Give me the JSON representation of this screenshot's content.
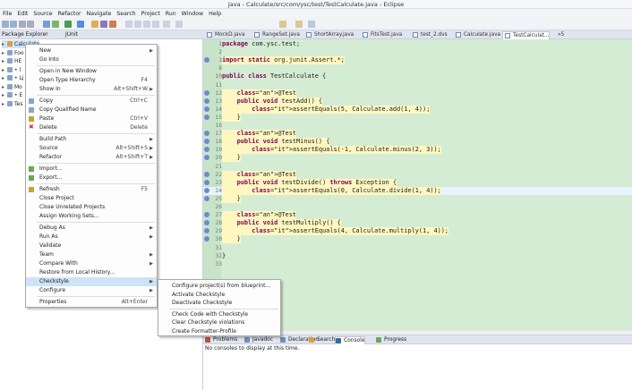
{
  "window": {
    "title": "Java - Calculate/src/com/ysc/test/TestCalculate.java - Eclipse"
  },
  "menubar": [
    "File",
    "Edit",
    "Source",
    "Refactor",
    "Navigate",
    "Search",
    "Project",
    "Run",
    "Window",
    "Help"
  ],
  "left_panel": {
    "tabs": [
      "Package Explorer",
      "JUnit"
    ],
    "tree": [
      {
        "label": "Calculate",
        "selected": true
      },
      {
        "label": "Foo"
      },
      {
        "label": "HE"
      },
      {
        "label": "• l"
      },
      {
        "label": "• Ц"
      },
      {
        "label": "Mo"
      },
      {
        "label": "• E"
      },
      {
        "label": "Tes"
      }
    ]
  },
  "editor_tabs": [
    {
      "label": "MockD.java"
    },
    {
      "label": "RangeSet.java"
    },
    {
      "label": "ShortArray.java"
    },
    {
      "label": "FitsTest.java"
    },
    {
      "label": "test_2.dvs"
    },
    {
      "label": "Calculate.java"
    },
    {
      "label": "TestCalculat...",
      "active": true
    },
    {
      "label": "»5"
    }
  ],
  "code": [
    {
      "n": "1",
      "text": "package com.ysc.test;"
    },
    {
      "n": "2",
      "text": ""
    },
    {
      "n": "3",
      "text": "import static org.junit.Assert.*;",
      "marker": true
    },
    {
      "n": "8",
      "text": ""
    },
    {
      "n": "10",
      "text": "public class TestCalculate {"
    },
    {
      "n": "11",
      "text": ""
    },
    {
      "n": "12",
      "text": "    @Test",
      "marker": true
    },
    {
      "n": "13",
      "text": "    public void testAdd() {",
      "marker": true
    },
    {
      "n": "14",
      "text": "        assertEquals(5, Calculate.add(1, 4));",
      "marker": true
    },
    {
      "n": "15",
      "text": "    }",
      "marker": true
    },
    {
      "n": "16",
      "text": ""
    },
    {
      "n": "17",
      "text": "    @Test",
      "marker": true
    },
    {
      "n": "18",
      "text": "    public void testMinus() {",
      "marker": true
    },
    {
      "n": "19",
      "text": "        assertEquals(-1, Calculate.minus(2, 3));",
      "marker": true
    },
    {
      "n": "20",
      "text": "    }",
      "marker": true
    },
    {
      "n": "21",
      "text": ""
    },
    {
      "n": "22",
      "text": "    @Test",
      "marker": true
    },
    {
      "n": "23",
      "text": "    public void testDivide() throws Exception {",
      "marker": true
    },
    {
      "n": "24",
      "text": "        assertEquals(0, Calculate.divide(1, 4));",
      "marker": true,
      "current": true
    },
    {
      "n": "25",
      "text": "    }",
      "marker": true
    },
    {
      "n": "26",
      "text": ""
    },
    {
      "n": "27",
      "text": "    @Test",
      "marker": true
    },
    {
      "n": "28",
      "text": "    public void testMultiply() {",
      "marker": true
    },
    {
      "n": "29",
      "text": "        assertEquals(4, Calculate.multiply(1, 4));",
      "marker": true
    },
    {
      "n": "30",
      "text": "    }",
      "marker": true
    },
    {
      "n": "31",
      "text": ""
    },
    {
      "n": "32",
      "text": "}"
    },
    {
      "n": "33",
      "text": ""
    }
  ],
  "context_menu": {
    "items": [
      {
        "label": "New",
        "submenu": true
      },
      {
        "label": "Go Into"
      },
      {
        "sep": true
      },
      {
        "label": "Open in New Window"
      },
      {
        "label": "Open Type Hierarchy",
        "shortcut": "F4"
      },
      {
        "label": "Show In",
        "shortcut": "Alt+Shift+W",
        "submenu": true
      },
      {
        "sep": true
      },
      {
        "label": "Copy",
        "shortcut": "Ctrl+C",
        "icon": "copy-icon"
      },
      {
        "label": "Copy Qualified Name",
        "icon": "copy-qualified-icon"
      },
      {
        "label": "Paste",
        "shortcut": "Ctrl+V",
        "icon": "paste-icon"
      },
      {
        "label": "Delete",
        "shortcut": "Delete",
        "icon": "delete-icon"
      },
      {
        "sep": true
      },
      {
        "label": "Build Path",
        "submenu": true
      },
      {
        "label": "Source",
        "shortcut": "Alt+Shift+S",
        "submenu": true
      },
      {
        "label": "Refactor",
        "shortcut": "Alt+Shift+T",
        "submenu": true
      },
      {
        "sep": true
      },
      {
        "label": "Import...",
        "icon": "import-icon"
      },
      {
        "label": "Export...",
        "icon": "export-icon"
      },
      {
        "sep": true
      },
      {
        "label": "Refresh",
        "shortcut": "F5",
        "icon": "refresh-icon"
      },
      {
        "label": "Close Project"
      },
      {
        "label": "Close Unrelated Projects"
      },
      {
        "label": "Assign Working Sets..."
      },
      {
        "sep": true
      },
      {
        "label": "Debug As",
        "submenu": true
      },
      {
        "label": "Run As",
        "submenu": true
      },
      {
        "label": "Validate"
      },
      {
        "label": "Team",
        "submenu": true
      },
      {
        "label": "Compare With",
        "submenu": true
      },
      {
        "label": "Restore from Local History..."
      },
      {
        "label": "Checkstyle",
        "submenu": true,
        "selected": true
      },
      {
        "label": "Configure",
        "submenu": true
      },
      {
        "sep": true
      },
      {
        "label": "Properties",
        "shortcut": "Alt+Enter"
      }
    ]
  },
  "checkstyle_submenu": {
    "items": [
      {
        "label": "Configure project(s) from blueprint..."
      },
      {
        "label": "Activate Checkstyle"
      },
      {
        "label": "Deactivate Checkstyle"
      },
      {
        "sep": true
      },
      {
        "label": "Check Code with Checkstyle"
      },
      {
        "label": "Clear Checkstyle violations"
      },
      {
        "label": "Create Formatter-Profile"
      }
    ]
  },
  "console_tabs": [
    {
      "label": "Problems"
    },
    {
      "label": "Javadoc"
    },
    {
      "label": "Declaration"
    },
    {
      "label": "Search"
    },
    {
      "label": "Console",
      "active": true
    },
    {
      "label": "Progress"
    }
  ],
  "console": {
    "message": "No consoles to display at this time."
  },
  "colors": {
    "editor_bg": "#d4ecd4",
    "highlight": "#fff7c0",
    "menu_selected": "#cde3f7"
  }
}
